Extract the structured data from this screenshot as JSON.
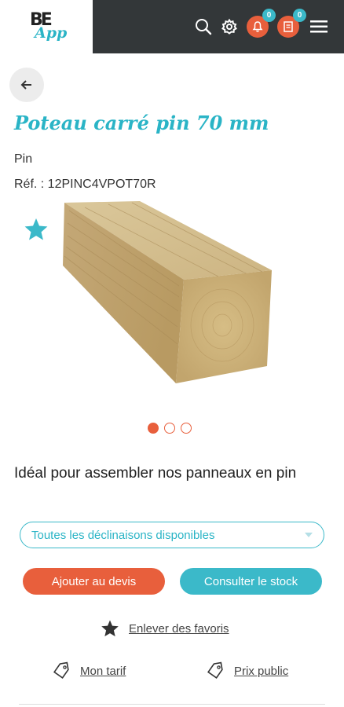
{
  "header": {
    "logo_letters": "BE",
    "logo_app": "App",
    "notifications_count": "0",
    "quotes_count": "0",
    "icons": [
      "search-icon",
      "gear-icon",
      "bell-icon",
      "document-icon",
      "menu-icon"
    ],
    "colors": {
      "bar": "#333739",
      "accent_orange": "#e85f3c",
      "accent_teal": "#3bb9c9"
    }
  },
  "product": {
    "title": "Poteau carré pin 70 mm",
    "material": "Pin",
    "reference": "Réf. : 12PINC4VPOT70R",
    "favorite": true,
    "carousel": {
      "total": 3,
      "active": 1
    },
    "description": "Idéal pour assembler nos panneaux en pin"
  },
  "actions": {
    "variants_select": "Toutes les déclinaisons disponibles",
    "add_quote": "Ajouter au devis",
    "check_stock": "Consulter le stock",
    "remove_favorite": "Enlever des favoris",
    "my_price": "Mon tarif",
    "public_price": "Prix public"
  }
}
